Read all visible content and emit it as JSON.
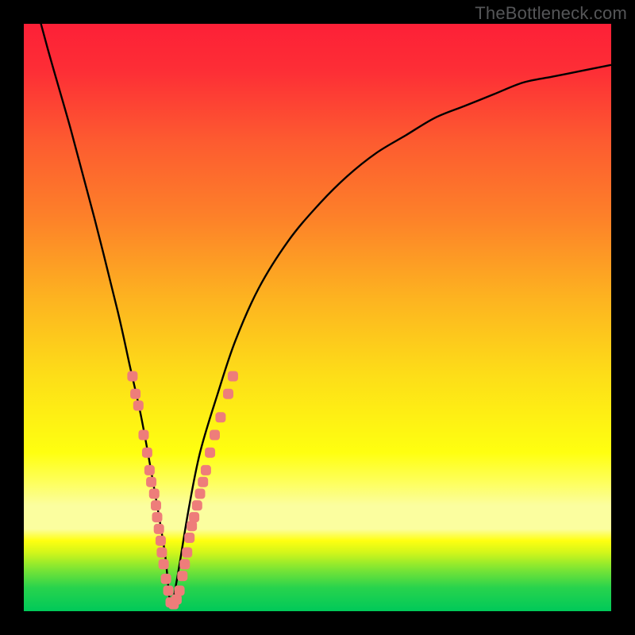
{
  "watermark": "TheBottleneck.com",
  "colors": {
    "frame": "#000000",
    "curve_stroke": "#000000",
    "marker_fill": "#ee7d7a",
    "gradient_stops": [
      {
        "offset": 0.0,
        "color": "#fd2037"
      },
      {
        "offset": 0.08,
        "color": "#fd2e36"
      },
      {
        "offset": 0.2,
        "color": "#fd5b30"
      },
      {
        "offset": 0.33,
        "color": "#fd8129"
      },
      {
        "offset": 0.47,
        "color": "#fdb420"
      },
      {
        "offset": 0.6,
        "color": "#fdde18"
      },
      {
        "offset": 0.7,
        "color": "#fef812"
      },
      {
        "offset": 0.73,
        "color": "#ffff10"
      },
      {
        "offset": 0.78,
        "color": "#feff5c"
      },
      {
        "offset": 0.82,
        "color": "#fbfe9f"
      },
      {
        "offset": 0.86,
        "color": "#fbfe9f"
      },
      {
        "offset": 0.88,
        "color": "#ffff10"
      },
      {
        "offset": 0.9,
        "color": "#d2f61a"
      },
      {
        "offset": 0.93,
        "color": "#78e435"
      },
      {
        "offset": 0.96,
        "color": "#28d34d"
      },
      {
        "offset": 1.0,
        "color": "#00c959"
      }
    ]
  },
  "chart_data": {
    "type": "line",
    "title": "",
    "xlabel": "",
    "ylabel": "",
    "xlim": [
      0,
      100
    ],
    "ylim": [
      0,
      100
    ],
    "note": "V-shaped bottleneck curve; y≈0 near x≈25; values are approximate, read from the plot's shape against the gradient bands.",
    "curve": {
      "x": [
        0,
        4,
        8,
        12,
        16,
        18,
        20,
        22,
        24,
        25,
        26,
        28,
        30,
        33,
        36,
        40,
        45,
        50,
        55,
        60,
        65,
        70,
        75,
        80,
        85,
        90,
        95,
        100
      ],
      "y": [
        111,
        96,
        82,
        67,
        51,
        42,
        33,
        22,
        10,
        1,
        5,
        17,
        27,
        37,
        46,
        55,
        63,
        69,
        74,
        78,
        81,
        84,
        86,
        88,
        90,
        91,
        92,
        93
      ]
    },
    "markers_left": [
      {
        "x": 18.5,
        "y": 40
      },
      {
        "x": 19.0,
        "y": 37
      },
      {
        "x": 19.5,
        "y": 35
      },
      {
        "x": 20.4,
        "y": 30
      },
      {
        "x": 21.0,
        "y": 27
      },
      {
        "x": 21.4,
        "y": 24
      },
      {
        "x": 21.7,
        "y": 22
      },
      {
        "x": 22.2,
        "y": 20
      },
      {
        "x": 22.5,
        "y": 18
      },
      {
        "x": 22.7,
        "y": 16
      },
      {
        "x": 23.0,
        "y": 14
      },
      {
        "x": 23.3,
        "y": 12
      },
      {
        "x": 23.5,
        "y": 10
      },
      {
        "x": 23.8,
        "y": 8
      },
      {
        "x": 24.2,
        "y": 5.5
      },
      {
        "x": 24.6,
        "y": 3.5
      }
    ],
    "markers_bottom": [
      {
        "x": 25.0,
        "y": 1.5
      },
      {
        "x": 25.5,
        "y": 1.2
      },
      {
        "x": 26.0,
        "y": 2.0
      },
      {
        "x": 26.5,
        "y": 3.5
      }
    ],
    "markers_right": [
      {
        "x": 27.0,
        "y": 6
      },
      {
        "x": 27.4,
        "y": 8
      },
      {
        "x": 27.8,
        "y": 10
      },
      {
        "x": 28.2,
        "y": 12.5
      },
      {
        "x": 28.6,
        "y": 14.5
      },
      {
        "x": 29.0,
        "y": 16
      },
      {
        "x": 29.5,
        "y": 18
      },
      {
        "x": 30.0,
        "y": 20
      },
      {
        "x": 30.5,
        "y": 22
      },
      {
        "x": 31.0,
        "y": 24
      },
      {
        "x": 31.7,
        "y": 27
      },
      {
        "x": 32.5,
        "y": 30
      },
      {
        "x": 33.5,
        "y": 33
      },
      {
        "x": 34.8,
        "y": 37
      },
      {
        "x": 35.6,
        "y": 40
      }
    ]
  }
}
